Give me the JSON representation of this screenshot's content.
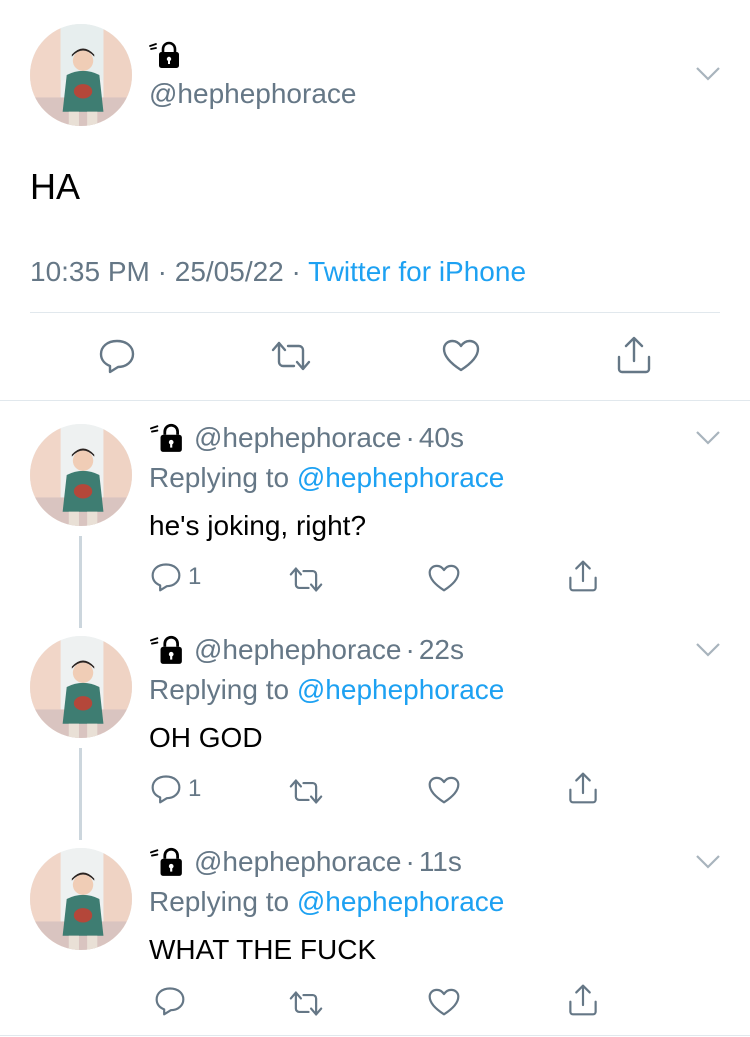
{
  "main_tweet": {
    "handle": "@hephephorace",
    "text": "HA",
    "time": "10:35 PM",
    "date": "25/05/22",
    "separator": "·",
    "source": "Twitter for iPhone"
  },
  "replies": [
    {
      "handle": "@hephephorace",
      "age": "40s",
      "replying_prefix": "Replying to",
      "replying_to": "@hephephorace",
      "text": "he's joking, right?",
      "reply_count": "1"
    },
    {
      "handle": "@hephephorace",
      "age": "22s",
      "replying_prefix": "Replying to",
      "replying_to": "@hephephorace",
      "text": "OH GOD",
      "reply_count": "1"
    },
    {
      "handle": "@hephephorace",
      "age": "11s",
      "replying_prefix": "Replying to",
      "replying_to": "@hephephorace",
      "text": "WHAT THE FUCK",
      "reply_count": ""
    }
  ],
  "icons": {
    "reply": "reply-icon",
    "retweet": "retweet-icon",
    "like": "heart-icon",
    "share": "share-icon",
    "lock": "lock-icon",
    "menu": "chevron-down-icon"
  },
  "colors": {
    "accent": "#1da1f2",
    "secondary_text": "#657786",
    "divider": "#e1e8ed"
  }
}
